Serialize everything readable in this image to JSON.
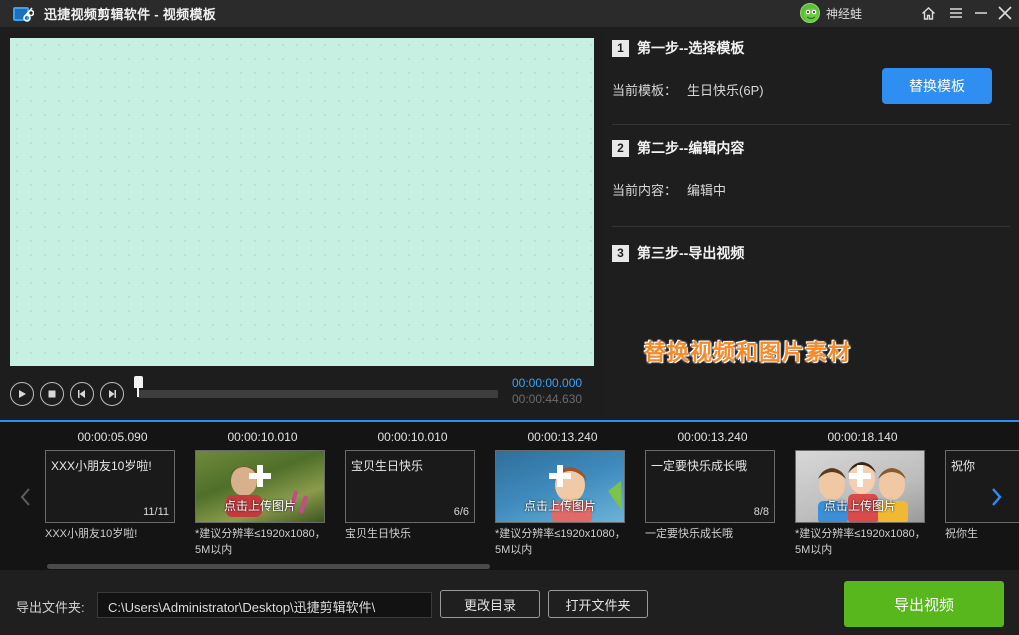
{
  "window": {
    "title": "迅捷视频剪辑软件 - 视频模板",
    "user_name": "神经蛙"
  },
  "player": {
    "time_current": "00:00:00.000",
    "time_total": "00:00:44.630",
    "progress_fraction": 0
  },
  "steps": {
    "step1": {
      "num": "1",
      "title": "第一步--选择模板",
      "label": "当前模板：",
      "value": "生日快乐(6P)",
      "button": "替换模板"
    },
    "step2": {
      "num": "2",
      "title": "第二步--编辑内容",
      "label": "当前内容：",
      "value": "编辑中"
    },
    "step3": {
      "num": "3",
      "title": "第三步--导出视频"
    },
    "overlay_caption": "替换视频和图片素材"
  },
  "timeline": {
    "clips": [
      {
        "time": "00:00:05.090",
        "type": "text",
        "text": "XXX小朋友10岁啦!",
        "count": "11/11",
        "note": "XXX小朋友10岁啦!"
      },
      {
        "time": "00:00:10.010",
        "type": "image",
        "upload_label": "点击上传图片",
        "note": "*建议分辨率≤1920x1080，5M以内"
      },
      {
        "time": "00:00:10.010",
        "type": "text",
        "text": "宝贝生日快乐",
        "count": "6/6",
        "note": "宝贝生日快乐"
      },
      {
        "time": "00:00:13.240",
        "type": "image",
        "upload_label": "点击上传图片",
        "note": "*建议分辨率≤1920x1080，5M以内"
      },
      {
        "time": "00:00:13.240",
        "type": "text",
        "text": "一定要快乐成长哦",
        "count": "8/8",
        "note": "一定要快乐成长哦"
      },
      {
        "time": "00:00:18.140",
        "type": "image",
        "upload_label": "点击上传图片",
        "note": "*建议分辨率≤1920x1080，5M以内"
      },
      {
        "time": "",
        "type": "text",
        "text": "祝你",
        "count": "",
        "note": "祝你生"
      }
    ]
  },
  "export": {
    "folder_label": "导出文件夹:",
    "folder_path": "C:\\Users\\Administrator\\Desktop\\迅捷剪辑软件\\",
    "change_dir": "更改目录",
    "open_folder": "打开文件夹",
    "export_button": "导出视频"
  },
  "colors": {
    "accent_blue": "#2e8ef2",
    "export_green": "#57b71d",
    "caption_orange": "#f58a2a",
    "preview_mint": "#c8f0e2"
  },
  "icons": [
    "app-logo-icon",
    "home-icon",
    "menu-icon",
    "minimize-icon",
    "close-icon",
    "play-icon",
    "stop-icon",
    "prev-frame-icon",
    "next-frame-icon",
    "chevron-left-icon",
    "chevron-right-icon",
    "plus-icon"
  ]
}
